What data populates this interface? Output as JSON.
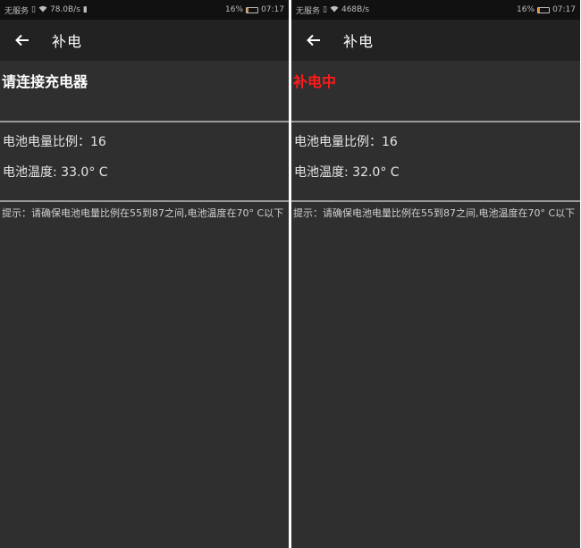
{
  "screens": [
    {
      "statusbar": {
        "carrier": "无服务",
        "speed": "78.0B/s",
        "battery_percent": "16%",
        "battery_level": 0.16,
        "time": "07:17"
      },
      "appbar": {
        "title": "补电"
      },
      "status_message": "请连接充电器",
      "status_color": "#ffffff",
      "battery_ratio_line": "电池电量比例：16",
      "battery_temp_line": "电池温度: 33.0° C",
      "hint": "提示：请确保电池电量比例在55到87之间,电池温度在70° C以下"
    },
    {
      "statusbar": {
        "carrier": "无服务",
        "speed": "468B/s",
        "battery_percent": "16%",
        "battery_level": 0.16,
        "time": "07:17"
      },
      "appbar": {
        "title": "补电"
      },
      "status_message": "补电中",
      "status_color": "#ff1a1a",
      "battery_ratio_line": "电池电量比例：16",
      "battery_temp_line": "电池温度: 32.0° C",
      "hint": "提示：请确保电池电量比例在55到87之间,电池温度在70° C以下"
    }
  ]
}
